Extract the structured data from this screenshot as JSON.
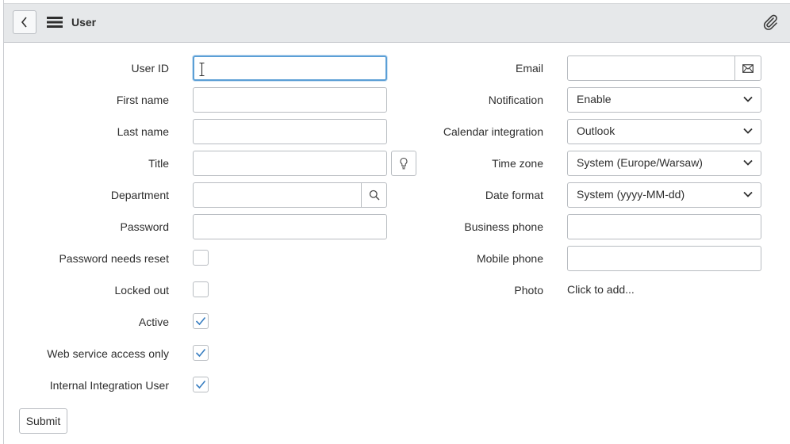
{
  "header": {
    "title": "User"
  },
  "left_fields": [
    {
      "label": "User ID",
      "value": ""
    },
    {
      "label": "First name",
      "value": ""
    },
    {
      "label": "Last name",
      "value": ""
    },
    {
      "label": "Title",
      "value": ""
    },
    {
      "label": "Department",
      "value": ""
    },
    {
      "label": "Password",
      "value": ""
    }
  ],
  "checkboxes": [
    {
      "label": "Password needs reset",
      "checked": false
    },
    {
      "label": "Locked out",
      "checked": false
    },
    {
      "label": "Active",
      "checked": true
    },
    {
      "label": "Web service access only",
      "checked": true
    },
    {
      "label": "Internal Integration User",
      "checked": true
    }
  ],
  "right_fields": {
    "email": {
      "label": "Email",
      "value": ""
    },
    "notification": {
      "label": "Notification",
      "value": "Enable"
    },
    "calendar": {
      "label": "Calendar integration",
      "value": "Outlook"
    },
    "timezone": {
      "label": "Time zone",
      "value": "System (Europe/Warsaw)"
    },
    "dateformat": {
      "label": "Date format",
      "value": "System (yyyy-MM-dd)"
    },
    "business_phone": {
      "label": "Business phone",
      "value": ""
    },
    "mobile_phone": {
      "label": "Mobile phone",
      "value": ""
    },
    "photo": {
      "label": "Photo",
      "value": "Click to add..."
    }
  },
  "actions": {
    "submit_label": "Submit"
  },
  "colors": {
    "focus_border": "#5b9fd6",
    "check_color": "#3a7fc1",
    "header_bg": "#e6e8ea"
  }
}
